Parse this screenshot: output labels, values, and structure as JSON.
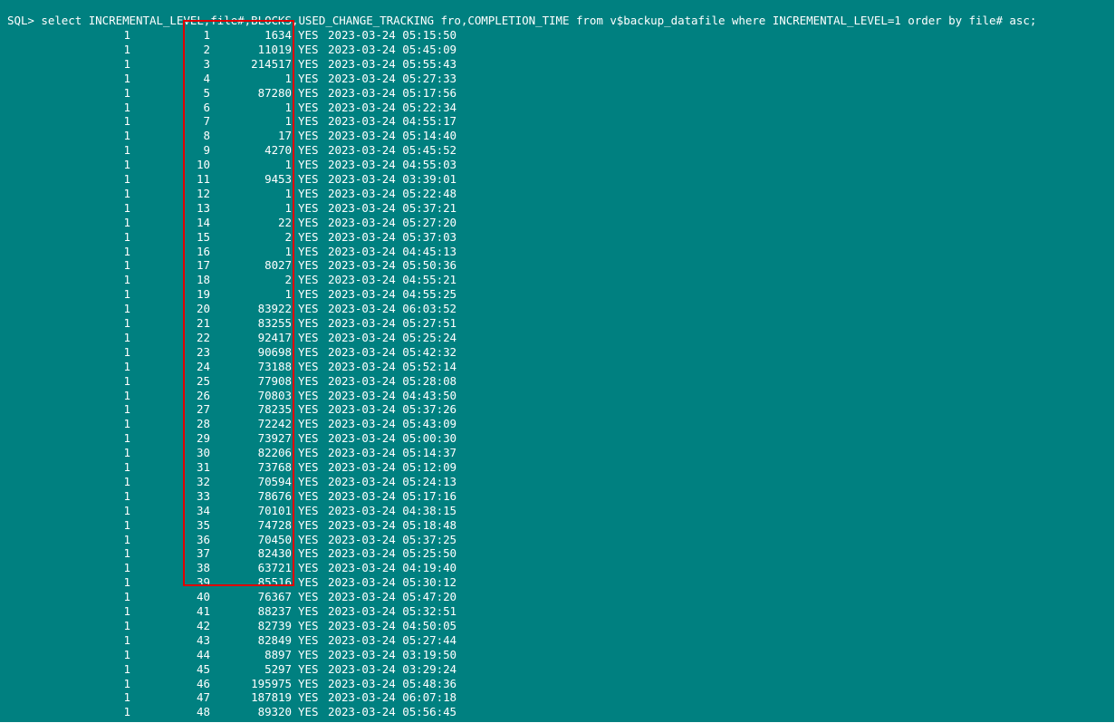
{
  "terminal": {
    "prompt_line": "SQL> select INCREMENTAL_LEVEL,file#,BLOCKS,USED_CHANGE_TRACKING fro,COMPLETION_TIME from v$backup_datafile where INCREMENTAL_LEVEL=1 order by file# asc;",
    "colors": {
      "background": "#008080",
      "text": "#ffffff",
      "highlight_border": "#e00000"
    },
    "rows": [
      {
        "level": "1",
        "file": "1",
        "blocks": "1634",
        "used": "YES",
        "time": "2023-03-24 05:15:50"
      },
      {
        "level": "1",
        "file": "2",
        "blocks": "11019",
        "used": "YES",
        "time": "2023-03-24 05:45:09"
      },
      {
        "level": "1",
        "file": "3",
        "blocks": "214517",
        "used": "YES",
        "time": "2023-03-24 05:55:43"
      },
      {
        "level": "1",
        "file": "4",
        "blocks": "1",
        "used": "YES",
        "time": "2023-03-24 05:27:33"
      },
      {
        "level": "1",
        "file": "5",
        "blocks": "87280",
        "used": "YES",
        "time": "2023-03-24 05:17:56"
      },
      {
        "level": "1",
        "file": "6",
        "blocks": "1",
        "used": "YES",
        "time": "2023-03-24 05:22:34"
      },
      {
        "level": "1",
        "file": "7",
        "blocks": "1",
        "used": "YES",
        "time": "2023-03-24 04:55:17"
      },
      {
        "level": "1",
        "file": "8",
        "blocks": "17",
        "used": "YES",
        "time": "2023-03-24 05:14:40"
      },
      {
        "level": "1",
        "file": "9",
        "blocks": "4270",
        "used": "YES",
        "time": "2023-03-24 05:45:52"
      },
      {
        "level": "1",
        "file": "10",
        "blocks": "1",
        "used": "YES",
        "time": "2023-03-24 04:55:03"
      },
      {
        "level": "1",
        "file": "11",
        "blocks": "9453",
        "used": "YES",
        "time": "2023-03-24 03:39:01"
      },
      {
        "level": "1",
        "file": "12",
        "blocks": "1",
        "used": "YES",
        "time": "2023-03-24 05:22:48"
      },
      {
        "level": "1",
        "file": "13",
        "blocks": "1",
        "used": "YES",
        "time": "2023-03-24 05:37:21"
      },
      {
        "level": "1",
        "file": "14",
        "blocks": "22",
        "used": "YES",
        "time": "2023-03-24 05:27:20"
      },
      {
        "level": "1",
        "file": "15",
        "blocks": "2",
        "used": "YES",
        "time": "2023-03-24 05:37:03"
      },
      {
        "level": "1",
        "file": "16",
        "blocks": "1",
        "used": "YES",
        "time": "2023-03-24 04:45:13"
      },
      {
        "level": "1",
        "file": "17",
        "blocks": "8027",
        "used": "YES",
        "time": "2023-03-24 05:50:36"
      },
      {
        "level": "1",
        "file": "18",
        "blocks": "2",
        "used": "YES",
        "time": "2023-03-24 04:55:21"
      },
      {
        "level": "1",
        "file": "19",
        "blocks": "1",
        "used": "YES",
        "time": "2023-03-24 04:55:25"
      },
      {
        "level": "1",
        "file": "20",
        "blocks": "83922",
        "used": "YES",
        "time": "2023-03-24 06:03:52"
      },
      {
        "level": "1",
        "file": "21",
        "blocks": "83255",
        "used": "YES",
        "time": "2023-03-24 05:27:51"
      },
      {
        "level": "1",
        "file": "22",
        "blocks": "92417",
        "used": "YES",
        "time": "2023-03-24 05:25:24"
      },
      {
        "level": "1",
        "file": "23",
        "blocks": "90698",
        "used": "YES",
        "time": "2023-03-24 05:42:32"
      },
      {
        "level": "1",
        "file": "24",
        "blocks": "73188",
        "used": "YES",
        "time": "2023-03-24 05:52:14"
      },
      {
        "level": "1",
        "file": "25",
        "blocks": "77908",
        "used": "YES",
        "time": "2023-03-24 05:28:08"
      },
      {
        "level": "1",
        "file": "26",
        "blocks": "70803",
        "used": "YES",
        "time": "2023-03-24 04:43:50"
      },
      {
        "level": "1",
        "file": "27",
        "blocks": "78235",
        "used": "YES",
        "time": "2023-03-24 05:37:26"
      },
      {
        "level": "1",
        "file": "28",
        "blocks": "72242",
        "used": "YES",
        "time": "2023-03-24 05:43:09"
      },
      {
        "level": "1",
        "file": "29",
        "blocks": "73927",
        "used": "YES",
        "time": "2023-03-24 05:00:30"
      },
      {
        "level": "1",
        "file": "30",
        "blocks": "82206",
        "used": "YES",
        "time": "2023-03-24 05:14:37"
      },
      {
        "level": "1",
        "file": "31",
        "blocks": "73768",
        "used": "YES",
        "time": "2023-03-24 05:12:09"
      },
      {
        "level": "1",
        "file": "32",
        "blocks": "70594",
        "used": "YES",
        "time": "2023-03-24 05:24:13"
      },
      {
        "level": "1",
        "file": "33",
        "blocks": "78676",
        "used": "YES",
        "time": "2023-03-24 05:17:16"
      },
      {
        "level": "1",
        "file": "34",
        "blocks": "70101",
        "used": "YES",
        "time": "2023-03-24 04:38:15"
      },
      {
        "level": "1",
        "file": "35",
        "blocks": "74728",
        "used": "YES",
        "time": "2023-03-24 05:18:48"
      },
      {
        "level": "1",
        "file": "36",
        "blocks": "70450",
        "used": "YES",
        "time": "2023-03-24 05:37:25"
      },
      {
        "level": "1",
        "file": "37",
        "blocks": "82430",
        "used": "YES",
        "time": "2023-03-24 05:25:50"
      },
      {
        "level": "1",
        "file": "38",
        "blocks": "63721",
        "used": "YES",
        "time": "2023-03-24 04:19:40"
      },
      {
        "level": "1",
        "file": "39",
        "blocks": "85516",
        "used": "YES",
        "time": "2023-03-24 05:30:12"
      },
      {
        "level": "1",
        "file": "40",
        "blocks": "76367",
        "used": "YES",
        "time": "2023-03-24 05:47:20"
      },
      {
        "level": "1",
        "file": "41",
        "blocks": "88237",
        "used": "YES",
        "time": "2023-03-24 05:32:51"
      },
      {
        "level": "1",
        "file": "42",
        "blocks": "82739",
        "used": "YES",
        "time": "2023-03-24 04:50:05"
      },
      {
        "level": "1",
        "file": "43",
        "blocks": "82849",
        "used": "YES",
        "time": "2023-03-24 05:27:44"
      },
      {
        "level": "1",
        "file": "44",
        "blocks": "8897",
        "used": "YES",
        "time": "2023-03-24 03:19:50"
      },
      {
        "level": "1",
        "file": "45",
        "blocks": "5297",
        "used": "YES",
        "time": "2023-03-24 03:29:24"
      },
      {
        "level": "1",
        "file": "46",
        "blocks": "195975",
        "used": "YES",
        "time": "2023-03-24 05:48:36"
      },
      {
        "level": "1",
        "file": "47",
        "blocks": "187819",
        "used": "YES",
        "time": "2023-03-24 06:07:18"
      },
      {
        "level": "1",
        "file": "48",
        "blocks": "89320",
        "used": "YES",
        "time": "2023-03-24 05:56:45"
      }
    ]
  }
}
